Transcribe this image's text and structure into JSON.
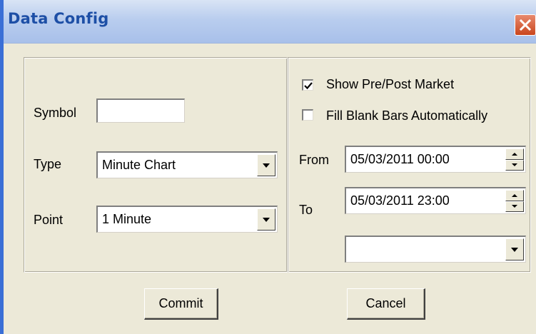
{
  "window": {
    "title": "Data Config"
  },
  "left": {
    "symbol_label": "Symbol",
    "symbol_value": "",
    "type_label": "Type",
    "type_value": "Minute Chart",
    "point_label": "Point",
    "point_value": "1 Minute"
  },
  "right": {
    "show_prepost_label": "Show Pre/Post Market",
    "show_prepost_checked": true,
    "fill_blank_label": "Fill Blank Bars Automatically",
    "fill_blank_checked": false,
    "from_label": "From",
    "from_value": "05/03/2011 00:00",
    "to_label": "To",
    "to_value": "05/03/2011 23:00",
    "extra_select_value": ""
  },
  "buttons": {
    "commit": "Commit",
    "cancel": "Cancel"
  },
  "colors": {
    "title_text": "#1d4fa6",
    "title_bar": "#b9cdee",
    "dialog_bg": "#ece9d8",
    "close_button": "#d9623b"
  },
  "icons": {
    "close": "close-icon",
    "dropdown": "chevron-down-icon",
    "spin_up": "spin-up-icon",
    "spin_down": "spin-down-icon",
    "check": "checkmark-icon"
  }
}
